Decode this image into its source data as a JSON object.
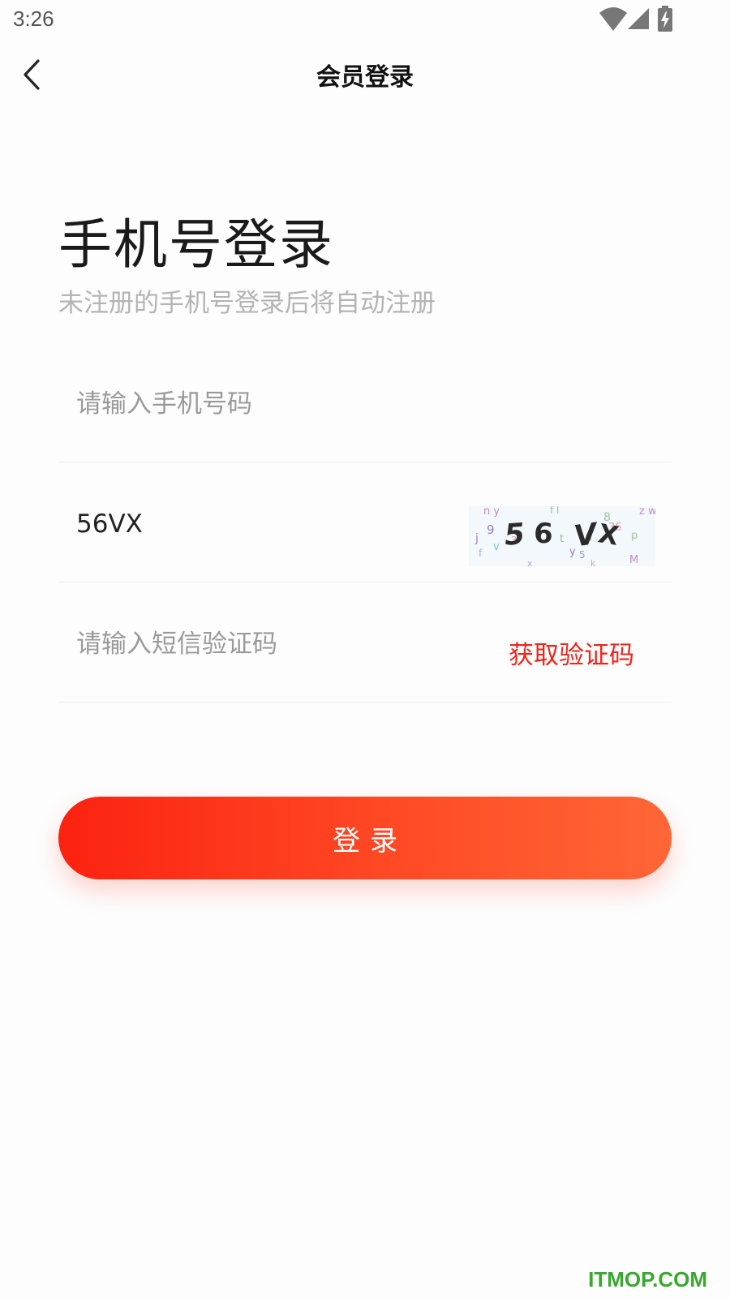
{
  "status_bar": {
    "time": "3:26",
    "icons": [
      "wifi-icon",
      "cellular-signal-icon",
      "battery-charging-icon"
    ]
  },
  "header": {
    "back_icon": "chevron-left-icon",
    "title": "会员登录"
  },
  "main": {
    "title": "手机号登录",
    "subtitle": "未注册的手机号登录后将自动注册"
  },
  "form": {
    "phone": {
      "value": "",
      "placeholder": "请输入手机号码"
    },
    "captcha": {
      "value": "56VX",
      "placeholder": "",
      "image_text": "56VX"
    },
    "sms": {
      "value": "",
      "placeholder": "请输入短信验证码",
      "get_code_label": "获取验证码"
    }
  },
  "login_button": {
    "label": "登录"
  },
  "watermark": "ITMOP.COM",
  "colors": {
    "accent": "#f0241a",
    "button_gradient_start": "#fc2210",
    "button_gradient_end": "#ff6636",
    "placeholder": "#9a9a9a",
    "subtitle": "#b4b4b4",
    "watermark": "#38a82f"
  }
}
